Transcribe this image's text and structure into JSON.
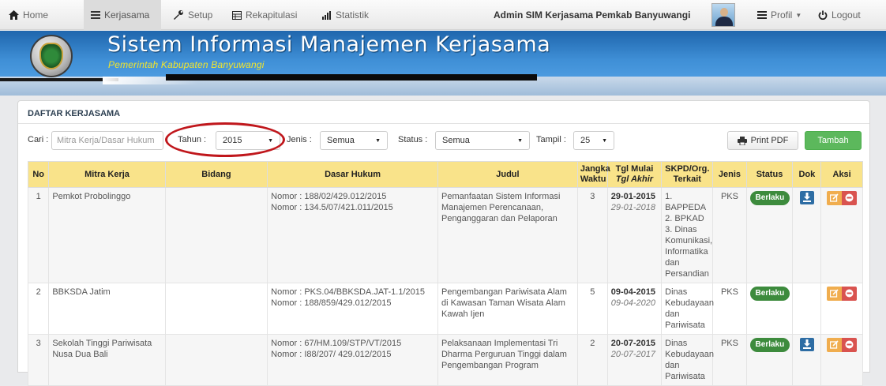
{
  "nav": {
    "home": "Home",
    "kerjasama": "Kerjasama",
    "setup": "Setup",
    "rekapitulasi": "Rekapitulasi",
    "statistik": "Statistik",
    "user": "Admin SIM Kerjasama Pemkab Banyuwangi",
    "profil": "Profil",
    "logout": "Logout"
  },
  "banner": {
    "title": "Sistem Informasi Manajemen Kerjasama",
    "subtitle": "Pemerintah Kabupaten Banyuwangi"
  },
  "panel": {
    "title": "DAFTAR KERJASAMA"
  },
  "filters": {
    "cari_label": "Cari :",
    "cari_placeholder": "Mitra Kerja/Dasar Hukum",
    "tahun_label": "Tahun :",
    "tahun_value": "2015",
    "jenis_label": "Jenis :",
    "jenis_value": "Semua",
    "status_label": "Status :",
    "status_value": "Semua",
    "tampil_label": "Tampil :",
    "tampil_value": "25",
    "print_label": "Print PDF",
    "tambah_label": "Tambah"
  },
  "table": {
    "headers": {
      "no": "No",
      "mitra": "Mitra Kerja",
      "bidang": "Bidang",
      "dasar": "Dasar Hukum",
      "judul": "Judul",
      "jangka1": "Jangka",
      "jangka2": "Waktu",
      "tgl1": "Tgl Mulai",
      "tgl2": "Tgl Akhir",
      "skpd1": "SKPD/Org.",
      "skpd2": "Terkait",
      "jenis": "Jenis",
      "status": "Status",
      "dok": "Dok",
      "aksi": "Aksi"
    },
    "rows": [
      {
        "no": "1",
        "mitra": "Pemkot Probolinggo",
        "bidang": "",
        "dasar1": "Nomor : 188/02/429.012/2015",
        "dasar2": "Nomor : 134.5/07/421.011/2015",
        "judul": "Pemanfaatan Sistem Informasi Manajemen Perencanaan, Penganggaran dan Pelaporan",
        "jangka": "3",
        "tgl_mulai": "29-01-2015",
        "tgl_akhir": "29-01-2018",
        "skpd1": "1. BAPPEDA",
        "skpd2": "2. BPKAD",
        "skpd3": "3. Dinas Komunikasi, Informatika dan Persandian",
        "jenis": "PKS",
        "status": "Berlaku"
      },
      {
        "no": "2",
        "mitra": "BBKSDA Jatim",
        "bidang": "",
        "dasar1": "Nomor : PKS.04/BBKSDA.JAT-1.1/2015",
        "dasar2": "Nomor : 188/859/429.012/2015",
        "judul": "Pengembangan Pariwisata Alam di Kawasan Taman Wisata Alam Kawah Ijen",
        "jangka": "5",
        "tgl_mulai": "09-04-2015",
        "tgl_akhir": "09-04-2020",
        "skpd1": "Dinas Kebudayaan dan Pariwisata",
        "jenis": "PKS",
        "status": "Berlaku"
      },
      {
        "no": "3",
        "mitra": "Sekolah Tinggi Pariwisata Nusa Dua Bali",
        "bidang": "",
        "dasar1": "Nomor : 67/HM.109/STP/VT/2015",
        "dasar2": "Nomor : I88/207/ 429.012/2015",
        "judul": "Pelaksanaan Implementasi Tri Dharma Perguruan Tinggi dalam Pengembangan Program",
        "jangka": "2",
        "tgl_mulai": "20-07-2015",
        "tgl_akhir": "20-07-2017",
        "skpd1": "Dinas Kebudayaan dan Pariwisata",
        "jenis": "PKS",
        "status": "Berlaku"
      }
    ]
  },
  "colors": {
    "header_yellow": "#f9e38a",
    "badge_green": "#3d8b3d",
    "link_blue": "#3476b5",
    "tambah_green": "#5cb85c",
    "ellipse_red": "#c0171c"
  }
}
